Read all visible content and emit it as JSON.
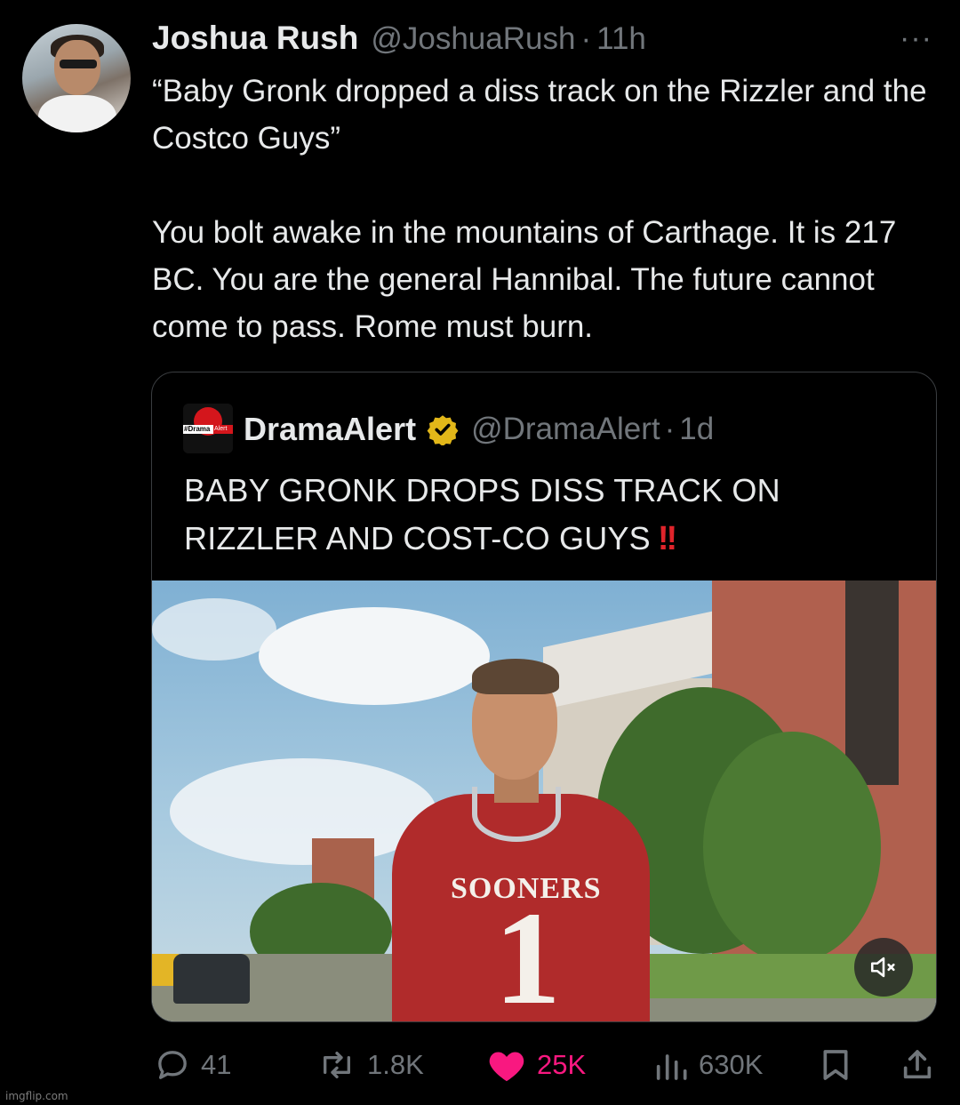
{
  "tweet": {
    "author_name": "Joshua Rush",
    "author_handle": "@JoshuaRush",
    "separator": "·",
    "time": "11h",
    "more_icon": "···",
    "text_para1": "“Baby Gronk dropped a diss track on the Rizzler and the Costco Guys”",
    "text_para2": "You bolt awake in the mountains of Carthage. It is 217 BC. You are the general Hannibal. The future cannot come to pass. Rome must burn."
  },
  "quote": {
    "logo_text_left": "#Drama",
    "logo_text_right": "Alert",
    "author_name": "DramaAlert",
    "author_handle": "@DramaAlert",
    "separator": "·",
    "time": "1d",
    "text": "BABY GRONK DROPS DISS TRACK ON RIZZLER AND COST-CO GUYS",
    "emphasis": "!!",
    "media_jersey_text": "SOONERS",
    "media_jersey_number": "1"
  },
  "actions": {
    "replies": "41",
    "reposts": "1.8K",
    "likes": "25K",
    "views": "630K"
  },
  "colors": {
    "background": "#000000",
    "text": "#e7e9ea",
    "muted": "#71767b",
    "like_pink": "#f91880",
    "verified_gold": "#e2b719",
    "alert_red": "#e0242b"
  },
  "watermark": "imgflip.com"
}
